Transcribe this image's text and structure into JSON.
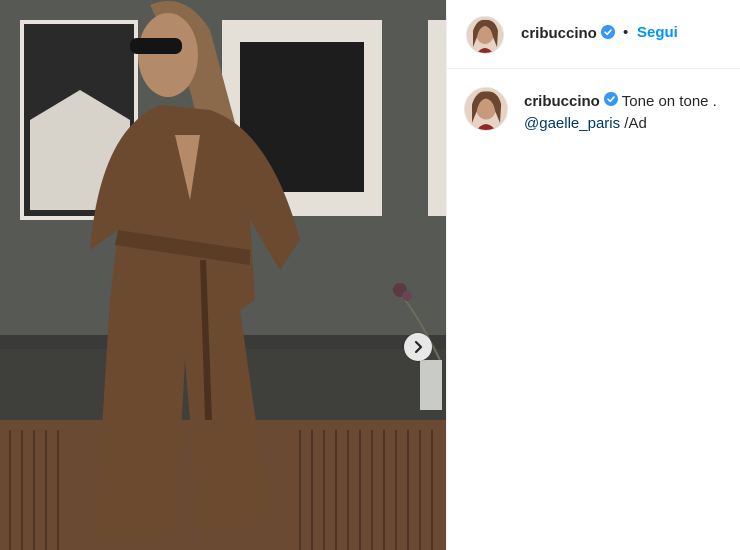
{
  "post": {
    "author": {
      "username": "cribuccino",
      "verified": true,
      "verified_icon": "verified-badge-icon",
      "verified_color": "#3897f0"
    },
    "header": {
      "separator": "•",
      "follow_label": "Segui",
      "follow_color": "#0095f6"
    },
    "caption": {
      "username": "cribuccino",
      "text": "Tone on tone .",
      "mention": "@gaelle_paris",
      "suffix": "/Ad"
    },
    "media": {
      "description_icon": "photo",
      "next_icon": "chevron-right-icon"
    }
  }
}
